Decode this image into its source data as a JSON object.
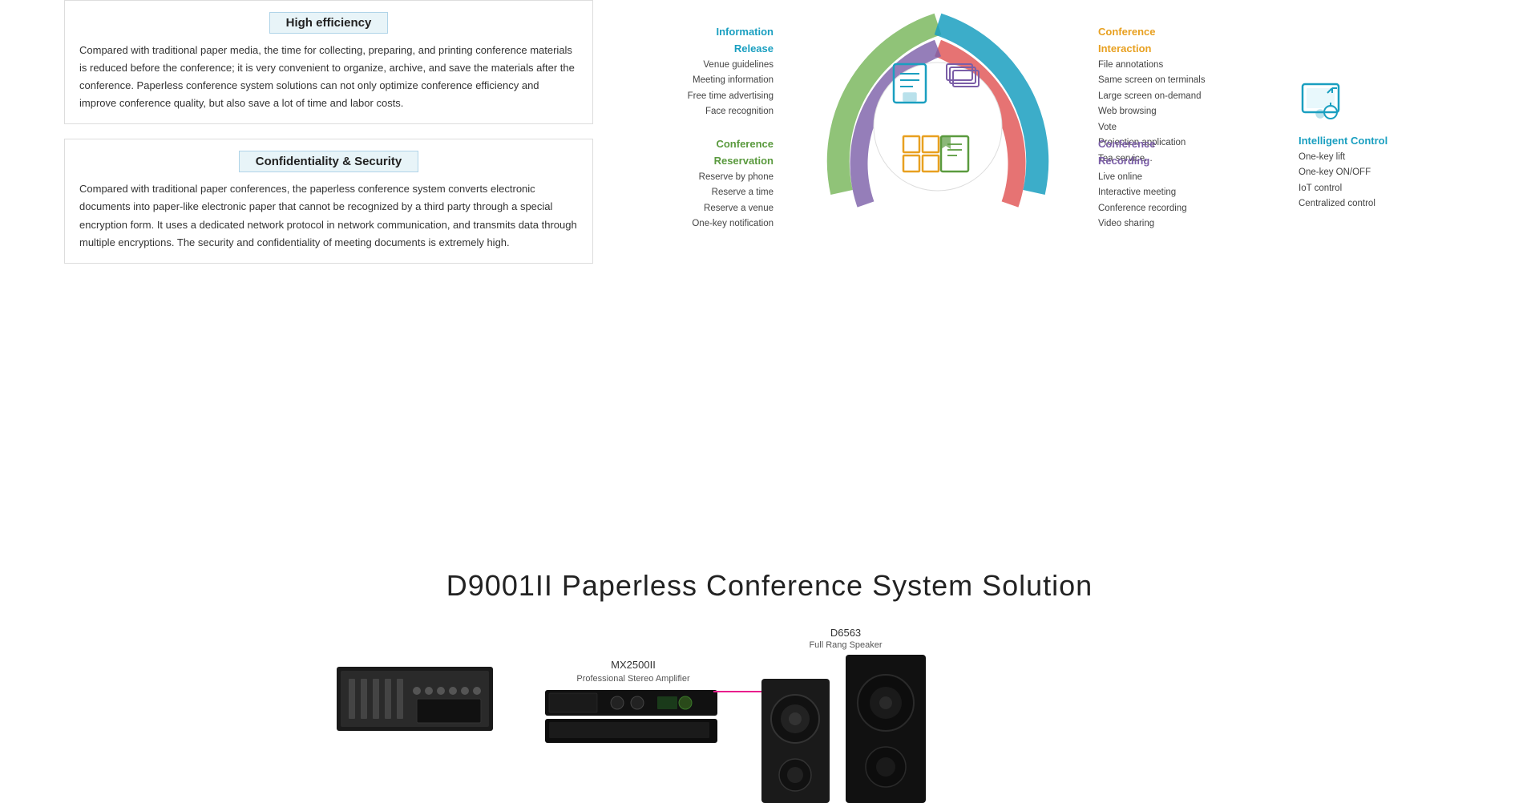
{
  "features": [
    {
      "id": "high-efficiency",
      "title": "High efficiency",
      "text": "Compared with traditional paper media, the time for collecting, preparing, and printing conference materials is reduced before the conference; it is very convenient to organize, archive, and save the materials after the conference. Paperless conference system solutions can not only optimize conference efficiency and improve conference quality, but also save a lot of time and labor costs."
    },
    {
      "id": "confidentiality",
      "title": "Confidentiality & Security",
      "text": "Compared with traditional paper conferences, the paperless conference system converts electronic documents into paper-like electronic paper that cannot be recognized by a third party through a special encryption form. It uses a dedicated network protocol in network communication, and transmits data through multiple encryptions. The security and confidentiality of meeting documents is extremely high."
    }
  ],
  "diagram": {
    "columns": {
      "left1": {
        "items": [
          "Venue guidelines",
          "Meeting information",
          "Free time advertising",
          "Face recognition"
        ],
        "label": "Information",
        "label2": "Release",
        "color": "#1a9fc0"
      },
      "left2": {
        "items": [
          "Reserve by phone",
          "Reserve a time",
          "Reserve a venue",
          "One-key notification"
        ],
        "label": "Conference",
        "label2": "Reservation",
        "color": "#5a9a3e"
      },
      "right1": {
        "items": [
          "File annotations",
          "Same screen on terminals",
          "Large screen on-demand",
          "Web browsing",
          "Vote",
          "Projection application",
          "Tea service..."
        ],
        "label": "Conference",
        "label2": "Interaction",
        "color": "#e8a020"
      },
      "right2": {
        "items": [
          "Live online",
          "Interactive meeting",
          "Conference recording",
          "Video sharing"
        ],
        "label": "Conference",
        "label2": "Recording",
        "color": "#7b5ea7"
      },
      "farRight": {
        "items": [
          "One-key lift",
          "One-key ON/OFF",
          "IoT control",
          "Centralized control"
        ],
        "label": "Intelligent Control",
        "color": "#1a9fc0"
      }
    }
  },
  "bottom": {
    "title": "D9001II Paperless Conference System Solution",
    "hardware": [
      {
        "id": "mixer",
        "label": "",
        "sublabel": ""
      },
      {
        "id": "amplifier",
        "label": "MX2500II",
        "sublabel": "Professional Stereo Amplifier"
      },
      {
        "id": "speaker",
        "label": "D6563",
        "sublabel": "Full Rang Speaker"
      }
    ]
  }
}
